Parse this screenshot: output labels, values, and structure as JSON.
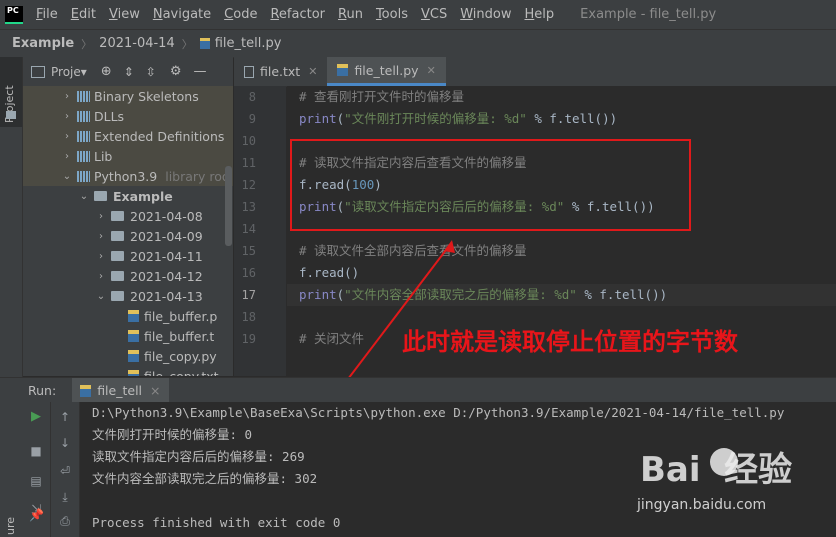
{
  "menubar": {
    "logo": "PC",
    "items": [
      {
        "u": "F",
        "rest": "ile"
      },
      {
        "u": "E",
        "rest": "dit"
      },
      {
        "u": "V",
        "rest": "iew"
      },
      {
        "u": "N",
        "rest": "avigate"
      },
      {
        "u": "C",
        "rest": "ode"
      },
      {
        "u": "R",
        "rest": "efactor"
      },
      {
        "u": "R",
        "rest": "un"
      },
      {
        "u": "T",
        "rest": "ools"
      },
      {
        "u": "V",
        "rest": "CS"
      },
      {
        "u": "W",
        "rest": "indow"
      },
      {
        "u": "H",
        "rest": "elp"
      }
    ],
    "window_title": "Example - file_tell.py"
  },
  "breadcrumb": [
    "Example",
    "2021-04-14",
    "file_tell.py"
  ],
  "toolstrip": {
    "project_tab": "Project",
    "bottom_label": "ure"
  },
  "project_panel": {
    "title": "Proje▾",
    "tree": [
      {
        "label": "Binary Skeletons",
        "type": "lib",
        "arrow": "›",
        "indent": 1
      },
      {
        "label": "DLLs",
        "type": "lib",
        "arrow": "›",
        "indent": 1
      },
      {
        "label": "Extended Definitions",
        "type": "lib",
        "arrow": "›",
        "indent": 1
      },
      {
        "label": "Lib",
        "type": "lib",
        "arrow": "›",
        "indent": 1
      },
      {
        "label": "Python3.9",
        "type": "lib",
        "arrow": "⌄",
        "indent": 1,
        "muted": "library roo"
      },
      {
        "label": "Example",
        "type": "folder",
        "arrow": "⌄",
        "indent": 2,
        "bold": true
      },
      {
        "label": "2021-04-08",
        "type": "folder",
        "arrow": "›",
        "indent": 3
      },
      {
        "label": "2021-04-09",
        "type": "folder",
        "arrow": "›",
        "indent": 3
      },
      {
        "label": "2021-04-11",
        "type": "folder",
        "arrow": "›",
        "indent": 3
      },
      {
        "label": "2021-04-12",
        "type": "folder",
        "arrow": "›",
        "indent": 3
      },
      {
        "label": "2021-04-13",
        "type": "folder",
        "arrow": "⌄",
        "indent": 3
      },
      {
        "label": "file_buffer.p",
        "type": "py",
        "arrow": "",
        "indent": 4
      },
      {
        "label": "file_buffer.t",
        "type": "py",
        "arrow": "",
        "indent": 4
      },
      {
        "label": "file_copy.py",
        "type": "py",
        "arrow": "",
        "indent": 4
      },
      {
        "label": "file_copy.txt",
        "type": "py",
        "arrow": "",
        "indent": 4
      }
    ]
  },
  "editor": {
    "tabs": [
      {
        "label": "file.txt",
        "active": false
      },
      {
        "label": "file_tell.py",
        "active": true
      }
    ],
    "line_numbers": [
      "8",
      "9",
      "10",
      "11",
      "12",
      "13",
      "14",
      "15",
      "16",
      "17",
      "18",
      "19"
    ],
    "lines": [
      [
        {
          "c": "cm",
          "t": "# 查看刚打开文件时的偏移量"
        }
      ],
      [
        {
          "c": "kw",
          "t": "print"
        },
        {
          "c": "fn",
          "t": "("
        },
        {
          "c": "st",
          "t": "\"文件刚打开时候的偏移量: %d\""
        },
        {
          "c": "fn",
          "t": " % f.tell())"
        }
      ],
      [],
      [
        {
          "c": "cm",
          "t": "# 读取文件指定内容后查看文件的偏移量"
        }
      ],
      [
        {
          "c": "fn",
          "t": "f.read("
        },
        {
          "c": "num",
          "t": "100"
        },
        {
          "c": "fn",
          "t": ")"
        }
      ],
      [
        {
          "c": "kw",
          "t": "print"
        },
        {
          "c": "fn",
          "t": "("
        },
        {
          "c": "st",
          "t": "\"读取文件指定内容后后的偏移量: %d\""
        },
        {
          "c": "fn",
          "t": " % f.tell())"
        }
      ],
      [],
      [
        {
          "c": "cm",
          "t": "# 读取文件全部内容后查看文件的偏移量"
        }
      ],
      [
        {
          "c": "fn",
          "t": "f.read()"
        }
      ],
      [
        {
          "c": "kw",
          "t": "print"
        },
        {
          "c": "fn",
          "t": "("
        },
        {
          "c": "st",
          "t": "\"文件内容全部读取完之后的偏移量: %d\""
        },
        {
          "c": "fn",
          "t": " % f.tell())"
        }
      ],
      [],
      [
        {
          "c": "cm",
          "t": "# 关闭文件"
        }
      ]
    ]
  },
  "annotation": "此时就是读取停止位置的字节数",
  "run": {
    "label": "Run:",
    "tab": "file_tell",
    "close": "×",
    "console": [
      "D:\\Python3.9\\Example\\BaseExa\\Scripts\\python.exe D:/Python3.9/Example/2021-04-14/file_tell.py",
      "文件刚打开时候的偏移量: 0",
      "读取文件指定内容后后的偏移量: 269",
      "文件内容全部读取完之后的偏移量: 302",
      "",
      "Process finished with exit code 0"
    ]
  },
  "watermark": {
    "logo": "Bai  经验",
    "url": "jingyan.baidu.com"
  },
  "colors": {
    "accent": "#4a88c7",
    "annotation_red": "#e0191a",
    "background": "#2b2b2b"
  }
}
